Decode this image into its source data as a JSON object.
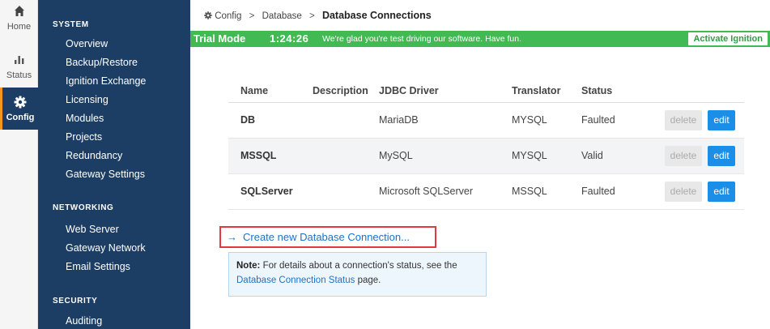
{
  "rail": {
    "items": [
      {
        "label": "Home",
        "icon": "home-icon"
      },
      {
        "label": "Status",
        "icon": "bar-chart-icon"
      },
      {
        "label": "Config",
        "icon": "gear-icon",
        "active": true
      }
    ]
  },
  "nav": {
    "system_heading": "SYSTEM",
    "system_items": [
      "Overview",
      "Backup/Restore",
      "Ignition Exchange",
      "Licensing",
      "Modules",
      "Projects",
      "Redundancy",
      "Gateway Settings"
    ],
    "networking_heading": "NETWORKING",
    "networking_items": [
      "Web Server",
      "Gateway Network",
      "Email Settings"
    ],
    "security_heading": "SECURITY",
    "security_items": [
      "Auditing"
    ]
  },
  "breadcrumb": {
    "items": [
      "Config",
      "Database",
      "Database Connections"
    ],
    "separator": ">"
  },
  "trial": {
    "title": "Trial Mode",
    "timer": "1:24:26",
    "message": "We're glad you're test driving our software. Have fun.",
    "activate_label": "Activate Ignition"
  },
  "table": {
    "headers": [
      "Name",
      "Description",
      "JDBC Driver",
      "Translator",
      "Status"
    ],
    "rows": [
      {
        "name": "DB",
        "description": "",
        "driver": "MariaDB",
        "translator": "MYSQL",
        "status": "Faulted"
      },
      {
        "name": "MSSQL",
        "description": "",
        "driver": "MySQL",
        "translator": "MYSQL",
        "status": "Valid"
      },
      {
        "name": "SQLServer",
        "description": "",
        "driver": "Microsoft SQLServer",
        "translator": "MSSQL",
        "status": "Faulted"
      }
    ],
    "delete_label": "delete",
    "edit_label": "edit"
  },
  "create_link": {
    "arrow": "→",
    "label": "Create new Database Connection..."
  },
  "note": {
    "bold": "Note:",
    "text_before": " For details about a connection's status, see the",
    "link": "Database Connection Status",
    "text_after": " page."
  },
  "colors": {
    "sidebar": "#1c3e64",
    "trial_banner": "#41ba53",
    "edit_button": "#1b8fe8",
    "highlight_border": "#e0393e",
    "active_accent": "#f7941d"
  }
}
